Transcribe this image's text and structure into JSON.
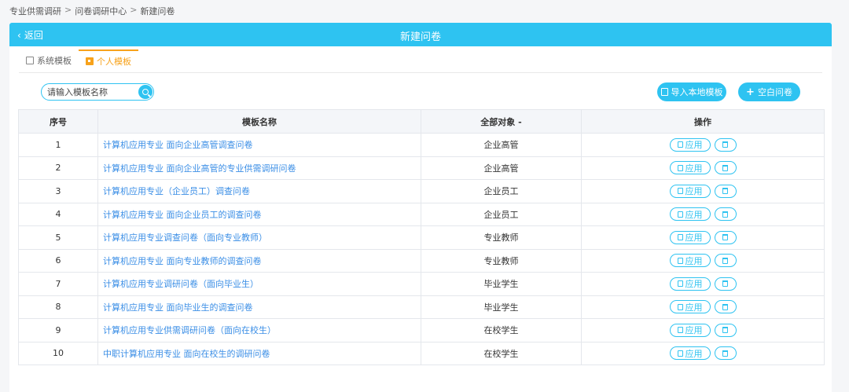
{
  "breadcrumb": [
    "专业供需调研",
    "问卷调研中心",
    "新建问卷"
  ],
  "breadcrumb_sep": ">",
  "header": {
    "back_label": "返回",
    "title": "新建问卷",
    "back_icon": "chevron-left-icon"
  },
  "tabs": [
    {
      "label": "系统模板",
      "active": false
    },
    {
      "label": "个人模板",
      "active": true
    }
  ],
  "search": {
    "placeholder": "请输入模板名称",
    "value": ""
  },
  "actions": {
    "import_label": "导入本地模板",
    "blank_label": "空白问卷"
  },
  "table": {
    "headers": [
      "序号",
      "模板名称",
      "全部对象 -",
      "操作"
    ],
    "apply_label": "应用",
    "rows": [
      {
        "no": "1",
        "name": "计算机应用专业 面向企业高管调查问卷",
        "target": "企业高管"
      },
      {
        "no": "2",
        "name": "计算机应用专业 面向企业高管的专业供需调研问卷",
        "target": "企业高管"
      },
      {
        "no": "3",
        "name": "计算机应用专业（企业员工）调查问卷",
        "target": "企业员工"
      },
      {
        "no": "4",
        "name": "计算机应用专业 面向企业员工的调查问卷",
        "target": "企业员工"
      },
      {
        "no": "5",
        "name": "计算机应用专业调查问卷（面向专业教师）",
        "target": "专业教师"
      },
      {
        "no": "6",
        "name": "计算机应用专业 面向专业教师的调查问卷",
        "target": "专业教师"
      },
      {
        "no": "7",
        "name": "计算机应用专业调研问卷（面向毕业生）",
        "target": "毕业学生"
      },
      {
        "no": "8",
        "name": "计算机应用专业 面向毕业生的调查问卷",
        "target": "毕业学生"
      },
      {
        "no": "9",
        "name": "计算机应用专业供需调研问卷（面向在校生）",
        "target": "在校学生"
      },
      {
        "no": "10",
        "name": "中职计算机应用专业 面向在校生的调研问卷",
        "target": "在校学生"
      }
    ]
  },
  "colors": {
    "accent": "#2ec3f1",
    "active_tab": "#f7a21b",
    "link": "#3a8ee6"
  }
}
